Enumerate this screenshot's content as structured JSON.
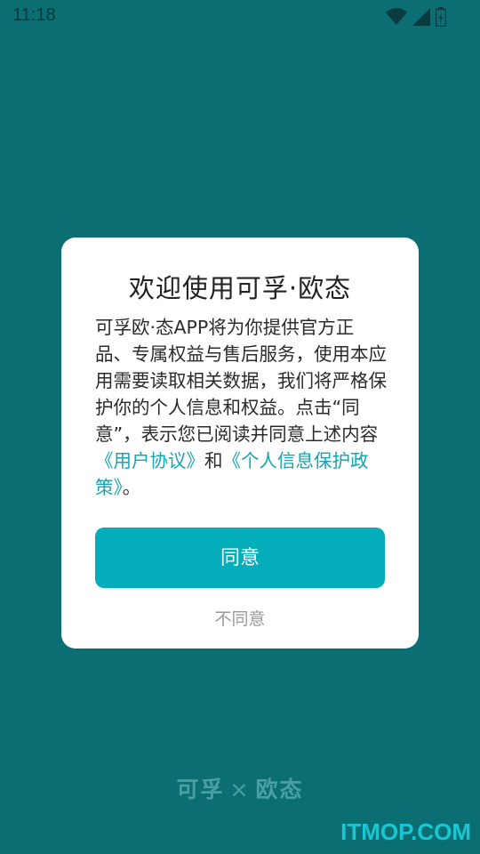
{
  "status_bar": {
    "time": "11:18",
    "icons": [
      "wifi-icon",
      "signal-icon",
      "battery-icon"
    ]
  },
  "dialog": {
    "title": "欢迎使用可孚·欧态",
    "body_text": "可孚欧·态APP将为你提供官方正品、专属权益与售后服务，使用本应用需要读取相关数据，我们将严格保护你的个人信息和权益。点击“同意”，表示您已阅读并同意上述内容",
    "user_agreement_link": "《用户协议》",
    "conjunction": "和",
    "privacy_policy_link": "《个人信息保护政策》",
    "end_punct": "。",
    "agree_label": "同意",
    "disagree_label": "不同意"
  },
  "brand": {
    "left": "可孚",
    "separator": "×",
    "right": "欧态"
  },
  "watermark": "ITMOP.COM",
  "colors": {
    "background": "#0b6e72",
    "accent": "#03adb9",
    "link": "#15a5b2"
  }
}
